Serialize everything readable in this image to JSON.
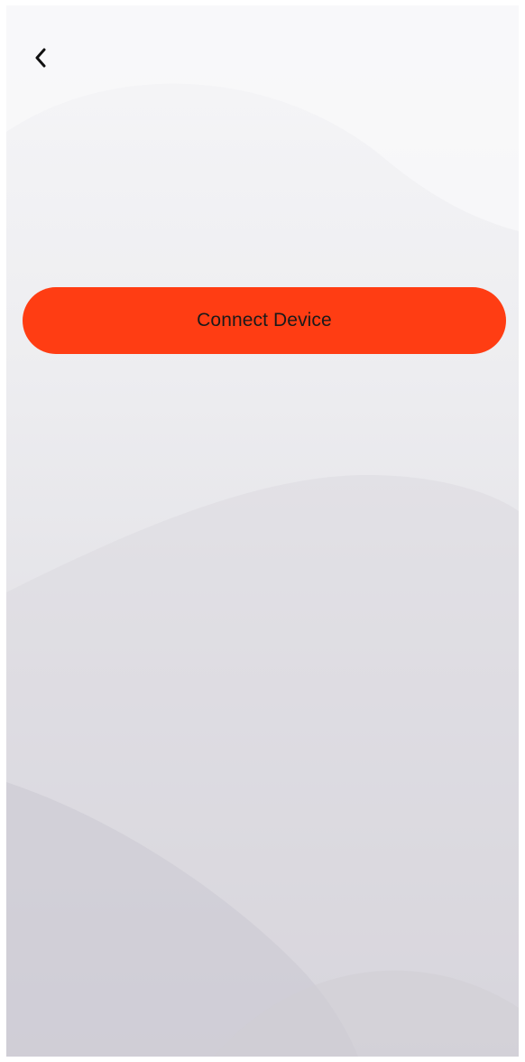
{
  "nav": {
    "back_icon": "chevron-left-icon"
  },
  "main": {
    "connect_button_label": "Connect Device"
  },
  "colors": {
    "accent": "#ff3d13",
    "button_text": "#1a1a1a",
    "background_top": "#f6f6f8",
    "background_bottom": "#d6d4db"
  }
}
